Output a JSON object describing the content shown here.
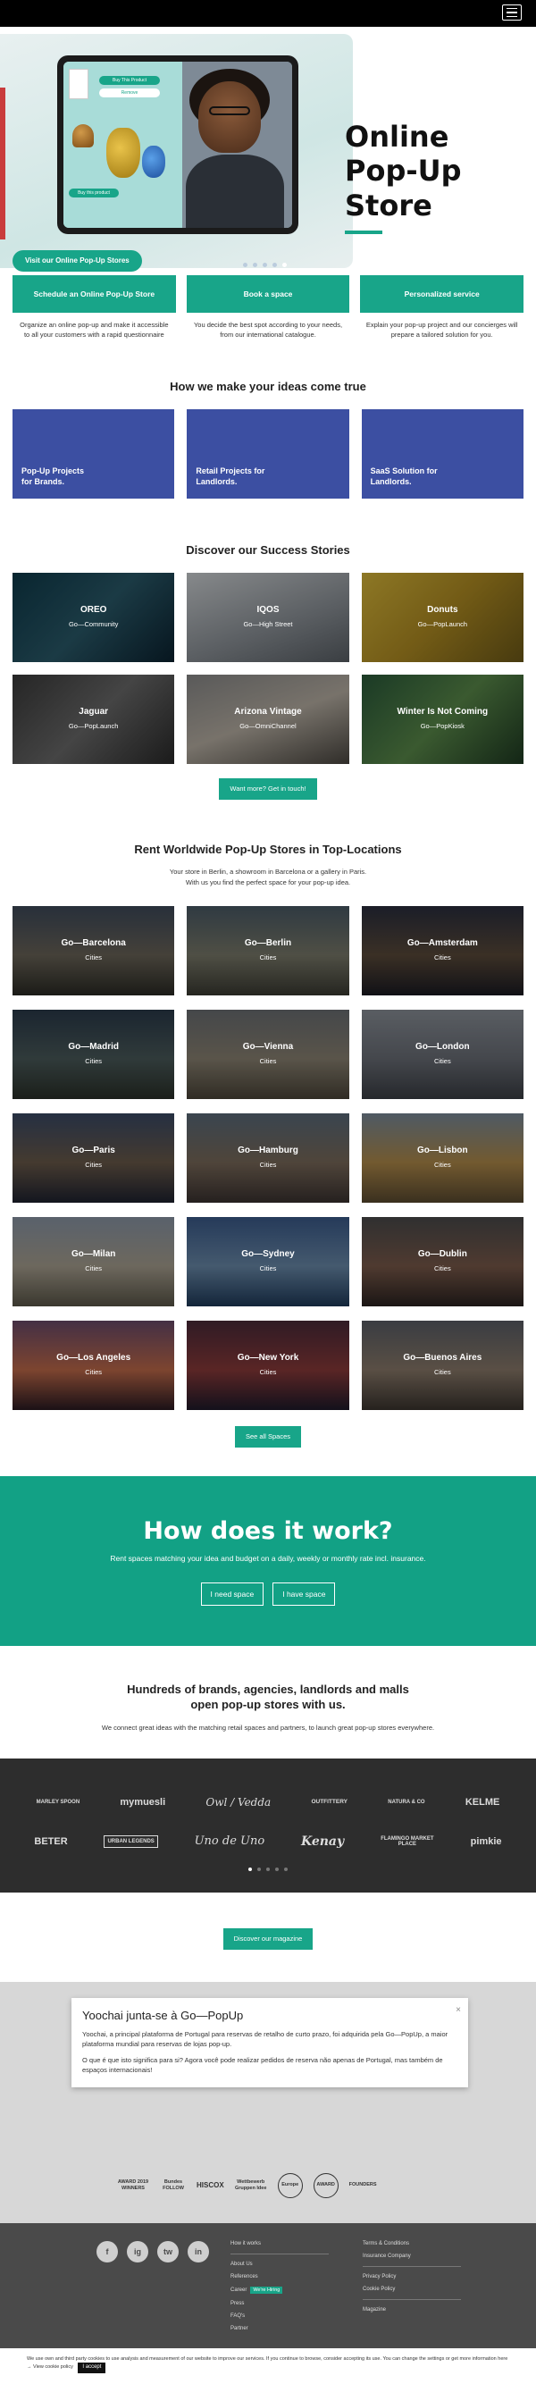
{
  "hero": {
    "title_line1": "Online",
    "title_line2": "Pop-Up",
    "title_line3": "Store",
    "cta": "Visit our Online Pop-Up Stores",
    "screen_pill1": "Buy This Product",
    "screen_pill2": "Remove",
    "screen_pill3": "Buy this product"
  },
  "services": [
    {
      "label": "Schedule an Online Pop-Up Store",
      "desc": "Organize an online pop-up and make it accessible to all your customers with a rapid questionnaire"
    },
    {
      "label": "Book a space",
      "desc": "You decide the best spot according to your needs, from our international catalogue."
    },
    {
      "label": "Personalized service",
      "desc": "Explain your pop-up project and our concierges will prepare a tailored solution for you."
    }
  ],
  "ideas": {
    "title": "How we make your ideas come true",
    "items": [
      "Pop-Up Projects\nfor Brands.",
      "Retail Projects for\nLandlords.",
      "SaaS Solution for\nLandlords."
    ]
  },
  "stories": {
    "title": "Discover our Success Stories",
    "items": [
      {
        "title": "OREO",
        "sub": "Go—Community"
      },
      {
        "title": "IQOS",
        "sub": "Go—High Street"
      },
      {
        "title": "Donuts",
        "sub": "Go—PopLaunch"
      },
      {
        "title": "Jaguar",
        "sub": "Go—PopLaunch"
      },
      {
        "title": "Arizona Vintage",
        "sub": "Go—OmniChannel"
      },
      {
        "title": "Winter Is Not Coming",
        "sub": "Go—PopKiosk"
      }
    ],
    "button": "Want more? Get in touch!"
  },
  "rent": {
    "title": "Rent Worldwide Pop-Up Stores in Top-Locations",
    "sub": "Your store in Berlin, a showroom in Barcelona or a gallery in Paris.\nWith us you find the perfect space for your pop-up idea.",
    "cities": [
      {
        "title": "Go—Barcelona",
        "sub": "Cities"
      },
      {
        "title": "Go—Berlin",
        "sub": "Cities"
      },
      {
        "title": "Go—Amsterdam",
        "sub": "Cities"
      },
      {
        "title": "Go—Madrid",
        "sub": "Cities"
      },
      {
        "title": "Go—Vienna",
        "sub": "Cities"
      },
      {
        "title": "Go—London",
        "sub": "Cities"
      },
      {
        "title": "Go—Paris",
        "sub": "Cities"
      },
      {
        "title": "Go—Hamburg",
        "sub": "Cities"
      },
      {
        "title": "Go—Lisbon",
        "sub": "Cities"
      },
      {
        "title": "Go—Milan",
        "sub": "Cities"
      },
      {
        "title": "Go—Sydney",
        "sub": "Cities"
      },
      {
        "title": "Go—Dublin",
        "sub": "Cities"
      },
      {
        "title": "Go—Los Angeles",
        "sub": "Cities"
      },
      {
        "title": "Go—New York",
        "sub": "Cities"
      },
      {
        "title": "Go—Buenos Aires",
        "sub": "Cities"
      }
    ],
    "button": "See all Spaces"
  },
  "how": {
    "title": "How does it work?",
    "sub": "Rent spaces matching your idea and budget on a daily, weekly or monthly rate incl. insurance.",
    "btn_need": "I need space",
    "btn_have": "I have space"
  },
  "brands": {
    "title": "Hundreds of brands, agencies, landlords and malls\nopen pop-up stores with us.",
    "sub": "We connect great ideas with the matching retail spaces and partners, to launch great pop-up stores everywhere.",
    "row1": [
      "MARLEY SPOON",
      "mymuesli",
      "Owl / Vedda",
      "OUTFITTERY",
      "NATURA & CO",
      "KELME"
    ],
    "row2": [
      "BETER",
      "URBAN LEGENDS",
      "Uno de Uno",
      "Kenay",
      "FLAMINGO MARKET PLACE",
      "pimkie"
    ]
  },
  "magazine": {
    "button": "Discover our magazine"
  },
  "popup": {
    "title": "Yoochai junta-se à Go—PopUp",
    "close": "×",
    "p1": "Yoochai, a principal plataforma de Portugal para reservas de retalho de curto prazo, foi adquirida pela Go—PopUp, a maior plataforma mundial para reservas de lojas pop-up.",
    "p2": "O que é que isto significa para si? Agora você pode realizar pedidos de reserva não apenas de Portugal, mas também de espaços internacionais!"
  },
  "badges": [
    "AWARD 2019 WINNERS",
    "Bundes FOLLOW",
    "HISCOX",
    "Wettbewerb Gruppen Idee",
    "Europe",
    "AWARD",
    "FOUNDERS"
  ],
  "footer": {
    "socials": [
      "f",
      "ig",
      "tw",
      "in"
    ],
    "col1": [
      "How it works",
      "About Us",
      "References",
      "Career",
      "Press",
      "FAQ's",
      "Partner"
    ],
    "hiring": "We're Hiring",
    "col2a": [
      "Terms & Conditions",
      "Insurance Company"
    ],
    "col2b": [
      "Privacy Policy",
      "Cookie Policy"
    ],
    "col2c": [
      "Magazine"
    ]
  },
  "cookie": {
    "text": "We use own and third party cookies to use analysis and measurement of our website to improve our services. If you continue to browse, consider accepting its use. You can change the settings or get more information here → View cookie policy",
    "button": "I accept"
  }
}
